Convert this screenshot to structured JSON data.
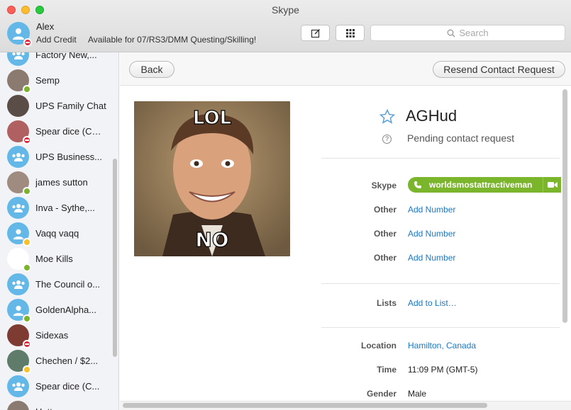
{
  "window": {
    "title": "Skype"
  },
  "me": {
    "name": "Alex",
    "credit_link": "Add Credit",
    "mood": "Available for 07/RS3/DMM Questing/Skilling!",
    "status": "dnd"
  },
  "toolbar": {
    "compose_icon": "compose-icon",
    "dialpad_icon": "dialpad-icon",
    "search_placeholder": "Search"
  },
  "contacts": [
    {
      "name": "Factory New,...",
      "avatar": "group",
      "status": "none"
    },
    {
      "name": "Semp",
      "avatar": "photo",
      "status": "online"
    },
    {
      "name": "UPS Family Chat",
      "avatar": "photo",
      "status": "none"
    },
    {
      "name": "Spear dice (CEO)",
      "avatar": "photo",
      "status": "dnd"
    },
    {
      "name": "UPS Business...",
      "avatar": "group",
      "status": "none"
    },
    {
      "name": "james sutton",
      "avatar": "photo",
      "status": "online"
    },
    {
      "name": "Inva - Sythe,...",
      "avatar": "group",
      "status": "none"
    },
    {
      "name": "Vaqq vaqq",
      "avatar": "default",
      "status": "away"
    },
    {
      "name": "Moe Kills",
      "avatar": "white",
      "status": "online"
    },
    {
      "name": "The Council o...",
      "avatar": "group",
      "status": "none"
    },
    {
      "name": "GoldenAlpha...",
      "avatar": "default",
      "status": "online"
    },
    {
      "name": "Sidexas",
      "avatar": "photo",
      "status": "dnd"
    },
    {
      "name": "Chechen / $2...",
      "avatar": "photo",
      "status": "away"
    },
    {
      "name": "Spear dice (C...",
      "avatar": "group",
      "status": "none"
    },
    {
      "name": "Hatter",
      "avatar": "photo",
      "status": "none"
    }
  ],
  "nav": {
    "back_label": "Back",
    "resend_label": "Resend Contact Request"
  },
  "profile": {
    "image_text_top": "LOL",
    "image_text_bottom": "NO",
    "name": "AGHud",
    "pending_text": "Pending contact request",
    "skype_label": "Skype",
    "skype_id": "worldsmostattractiveman",
    "phones": [
      {
        "label": "Other",
        "action": "Add Number"
      },
      {
        "label": "Other",
        "action": "Add Number"
      },
      {
        "label": "Other",
        "action": "Add Number"
      }
    ],
    "lists_label": "Lists",
    "lists_action": "Add to List…",
    "location_label": "Location",
    "location_value": "Hamilton, Canada",
    "time_label": "Time",
    "time_value": "11:09 PM (GMT-5)",
    "gender_label": "Gender",
    "gender_value": "Male"
  },
  "colors": {
    "accent_green": "#7ab52b",
    "link_blue": "#1b78c2",
    "avatar_blue": "#63b8e8",
    "status_dnd": "#e0263b",
    "status_online": "#7cb32c",
    "status_away": "#f7c12a"
  }
}
